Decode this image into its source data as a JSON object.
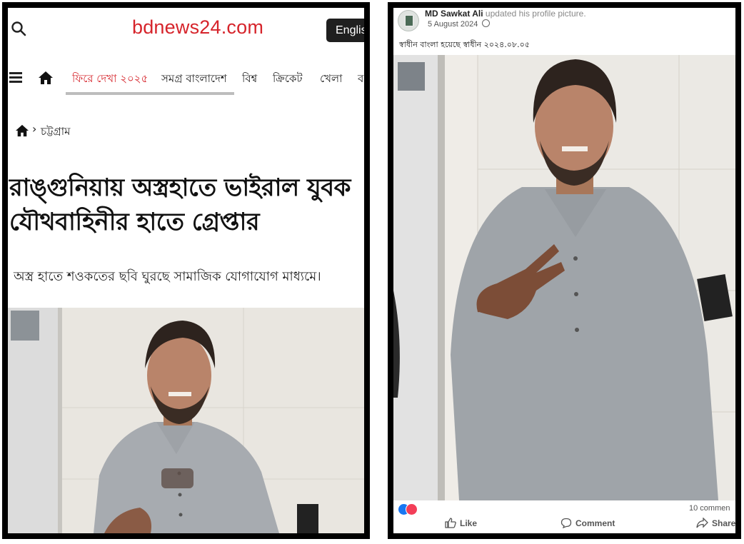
{
  "left_screenshot": {
    "site": {
      "logo": "bdnews24.com",
      "language_button": "English",
      "logo_color": "#d6242b"
    },
    "nav": {
      "items": [
        {
          "label": "ফিরে দেখা ২০২৫",
          "active": true
        },
        {
          "label": "সমগ্র বাংলাদেশ",
          "active": false
        },
        {
          "label": "বিশ্ব",
          "active": false
        },
        {
          "label": "ক্রিকেট",
          "active": false
        },
        {
          "label": "খেলা",
          "active": false
        },
        {
          "label": "ব",
          "active": false
        }
      ]
    },
    "breadcrumb": {
      "section": "চট্টগ্রাম"
    },
    "article": {
      "headline_line1": "রাঙ্গুনিয়ায় অস্ত্রহাতে ভাইরাল যুবক",
      "headline_line2": "যৌথবাহিনীর হাতে গ্রেপ্তার",
      "subheadline": "অস্ত্র হাতে শওকতের ছবি ঘুরছে সামাজিক যোগাযোগ মাধ্যমে।"
    }
  },
  "right_screenshot": {
    "post": {
      "author": "MD Sawkat Ali",
      "action": "updated his profile picture.",
      "date": "5 August 2024",
      "caption": "স্বাধীন বাংলা হয়েছে স্বাধীন ২০২৪.০৮.০৫"
    },
    "engagement": {
      "comment_count": "10 commen",
      "like_label": "Like",
      "comment_label": "Comment",
      "share_label": "Share"
    }
  }
}
